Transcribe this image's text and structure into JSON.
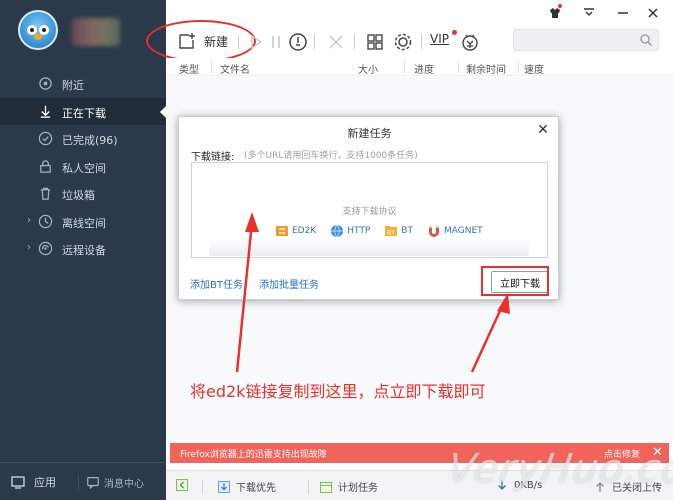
{
  "sidebar": {
    "items": [
      {
        "label": "附近",
        "icon": "location-icon"
      },
      {
        "label": "正在下载",
        "icon": "download-icon",
        "active": true
      },
      {
        "label": "已完成(96)",
        "icon": "check-circle-icon"
      },
      {
        "label": "私人空间",
        "icon": "lock-icon"
      },
      {
        "label": "垃圾箱",
        "icon": "trash-icon"
      },
      {
        "label": "离线空间",
        "icon": "cloud-icon"
      },
      {
        "label": "远程设备",
        "icon": "remote-device-icon"
      }
    ],
    "app_label": "应用",
    "message_label": "消息中心"
  },
  "toolbar": {
    "new_label": "新建",
    "vip_label": "VIP",
    "search_placeholder": ""
  },
  "columns": [
    "类型",
    "文件名",
    "大小",
    "进度",
    "剩余时间",
    "速度"
  ],
  "dialog": {
    "title": "新建任务",
    "link_label": "下载链接:",
    "link_hint": "(多个URL请用回车换行，支持1000条任务)",
    "protocols_title": "支持下载协议",
    "protocols": [
      {
        "label": "ED2K",
        "icon": "ed2k-icon"
      },
      {
        "label": "HTTP",
        "icon": "http-icon"
      },
      {
        "label": "BT",
        "icon": "bt-icon"
      },
      {
        "label": "MAGNET",
        "icon": "magnet-icon"
      }
    ],
    "add_bt_label": "添加BT任务",
    "add_batch_label": "添加批量任务",
    "download_now_label": "立即下载"
  },
  "annotation": "将ed2k链接复制到这里，点立即下载即可",
  "error_bar": {
    "message": "Firefox浏览器上的迅雷支持出现故障",
    "fix_label": "点击修复"
  },
  "status_bar": {
    "download_priority_label": "下载优先",
    "scheduled_task_label": "计划任务",
    "speed": "0KB/s",
    "upload_label": "已关闭上传"
  },
  "watermark": "VeryHuo.com",
  "colors": {
    "sidebar_bg": "#2a3a4b",
    "annotation_red": "#e8312c",
    "error_bar": "#f0645c",
    "link_blue": "#2a6fc4"
  }
}
